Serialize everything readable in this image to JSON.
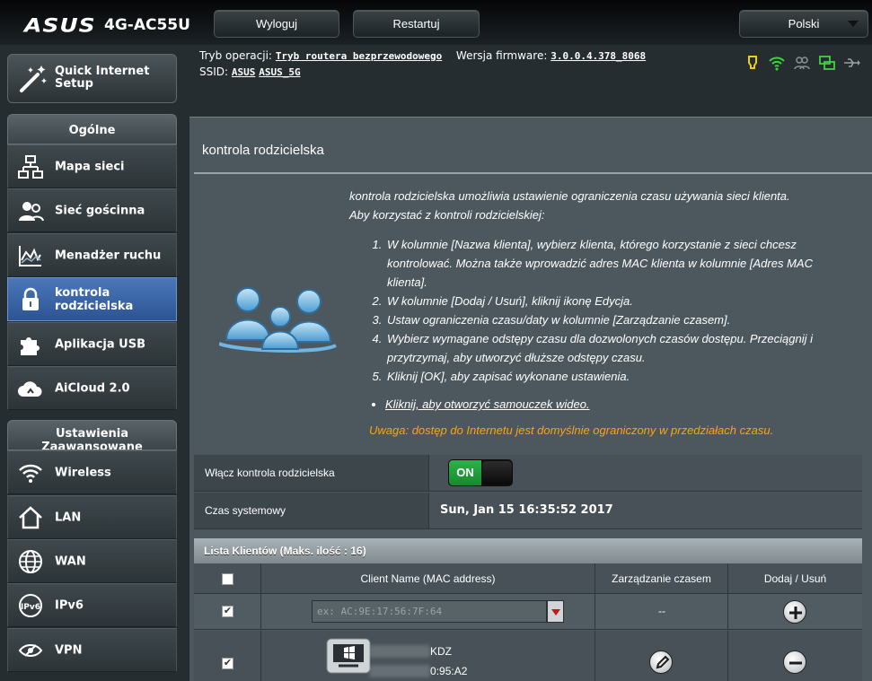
{
  "header": {
    "brand": "ASUS",
    "model": "4G-AC55U",
    "logout_label": "Wyloguj",
    "reboot_label": "Restartuj",
    "language_label": "Polski"
  },
  "status": {
    "mode_label": "Tryb operacji:",
    "mode_value": "Tryb routera bezprzewodowego",
    "firmware_label": "Wersja firmware:",
    "firmware_value": "3.0.0.4.378_8068",
    "ssid_label": "SSID:",
    "ssid_values": [
      "ASUS",
      "ASUS_5G"
    ],
    "icons": [
      "bulb-icon",
      "wifi-icon",
      "users-icon",
      "network-icon",
      "usb-icon"
    ]
  },
  "sidebar": {
    "qis_label": "Quick Internet Setup",
    "general_head": "Ogólne",
    "general_items": [
      {
        "label": "Mapa sieci",
        "icon": "network-map-icon"
      },
      {
        "label": "Sieć gościnna",
        "icon": "guest-network-icon"
      },
      {
        "label": "Menadżer ruchu",
        "icon": "traffic-icon"
      },
      {
        "label": "kontrola rodzicielska",
        "icon": "lock-icon",
        "active": true
      },
      {
        "label": "Aplikacja USB",
        "icon": "puzzle-icon"
      },
      {
        "label": "AiCloud 2.0",
        "icon": "cloud-icon"
      }
    ],
    "advanced_head": "Ustawienia Zaawansowane",
    "advanced_items": [
      {
        "label": "Wireless",
        "icon": "wireless-icon"
      },
      {
        "label": "LAN",
        "icon": "home-icon"
      },
      {
        "label": "WAN",
        "icon": "globe-icon"
      },
      {
        "label": "IPv6",
        "icon": "ipv6-icon"
      },
      {
        "label": "VPN",
        "icon": "vpn-icon"
      }
    ]
  },
  "main": {
    "title": "kontrola rodzicielska",
    "intro1": "kontrola rodzicielska umożliwia ustawienie ograniczenia czasu używania sieci klienta.",
    "intro2": "Aby korzystać z kontroli rodzicielskiej:",
    "steps": [
      "W kolumnie [Nazwa klienta], wybierz klienta, którego korzystanie z sieci chcesz kontrolować. Można także wprowadzić adres MAC klienta w kolumnie [Adres MAC klienta].",
      "W kolumnie [Dodaj / Usuń], kliknij ikonę Edycja.",
      "Ustaw ograniczenia czasu/daty w kolumnie [Zarządzanie czasem].",
      "Wybierz wymagane odstępy czasu dla dozwolonych czasów dostępu. Przeciągnij i przytrzymaj, aby utworzyć dłuższe odstępy czasu.",
      "Kliknij [OK], aby zapisać wykonane ustawienia."
    ],
    "tutorial_link": "Kliknij, aby otworzyć samouczek wideo.",
    "warning": "Uwaga: dostęp do Internetu jest domyślnie ograniczony w przedziałach czasu.",
    "enable_label": "Włącz kontrola rodzicielska",
    "toggle_state": "ON",
    "systime_label": "Czas systemowy",
    "systime_value": "Sun, Jan 15 16:35:52 2017",
    "client_list_title": "Lista Klientów (Maks. ilość : 16)",
    "columns": [
      "",
      "Client Name (MAC address)",
      "Zarządzanie czasem",
      "Dodaj / Usuń"
    ],
    "mac_placeholder": "ex: AC:9E:17:56:7F:64",
    "time_placeholder": "--",
    "client": {
      "name_suffix": "KDZ",
      "mac_suffix": "0:95:A2",
      "name_hidden": "████████",
      "mac_hidden": "████████"
    }
  },
  "colors": {
    "accent_active": "#3b67a8",
    "toggle_on": "#22a03c",
    "warning": "#ffa500"
  }
}
